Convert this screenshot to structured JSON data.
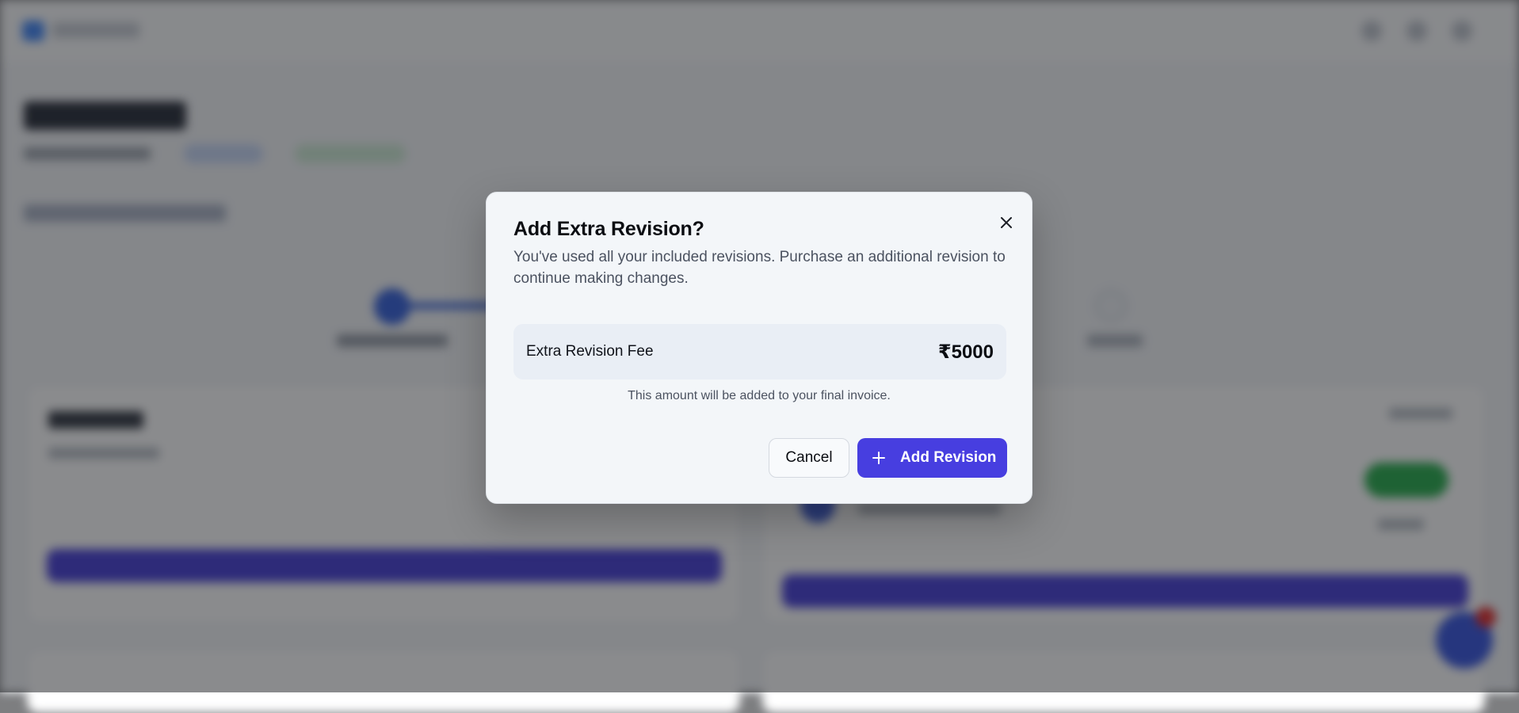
{
  "modal": {
    "title": "Add Extra Revision?",
    "description": "You've used all your included revisions. Purchase an additional revision to continue making changes.",
    "fee_label": "Extra Revision Fee",
    "fee_amount": "₹5000",
    "fee_note": "This amount will be added to your final invoice.",
    "cancel_label": "Cancel",
    "confirm_label": "Add Revision",
    "close_icon": "close-icon",
    "confirm_icon": "plus-icon"
  },
  "colors": {
    "primary": "#473ee0",
    "modal_bg": "#f3f6f9",
    "fee_box_bg": "#e9eef5"
  }
}
